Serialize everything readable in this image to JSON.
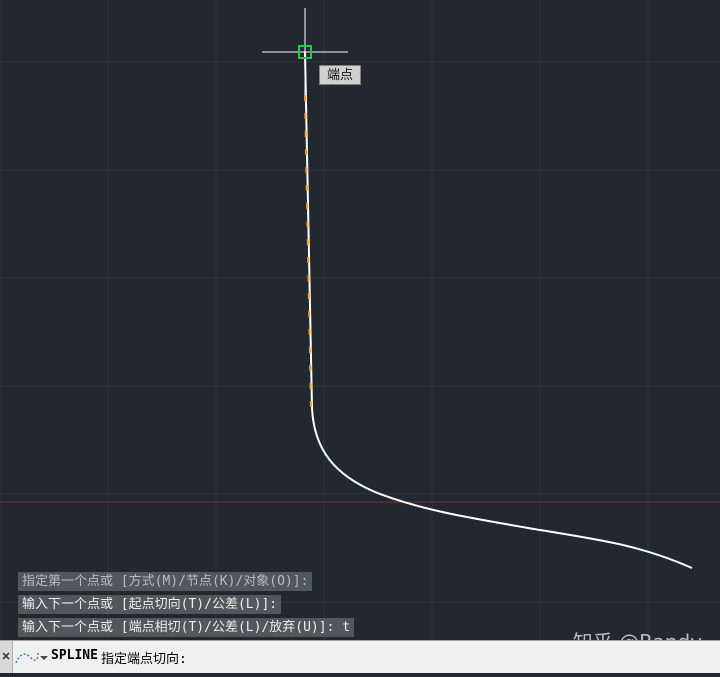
{
  "canvas": {
    "snap_tooltip": "端点",
    "colors": {
      "background": "#212830",
      "grid": "#2c3540",
      "axis": "#7a2e2e",
      "spline": "#ffffff",
      "highlight": "#ff9f1c",
      "snap_marker": "#27c93f"
    }
  },
  "command_history": [
    "指定第一个点或 [方式(M)/节点(K)/对象(O)]:",
    "输入下一个点或 [起点切向(T)/公差(L)]:",
    "输入下一个点或 [端点相切(T)/公差(L)/放弃(U)]: t"
  ],
  "command_line": {
    "command": "SPLINE",
    "prompt": "指定端点切向:"
  },
  "watermark": "知乎 @Randy"
}
